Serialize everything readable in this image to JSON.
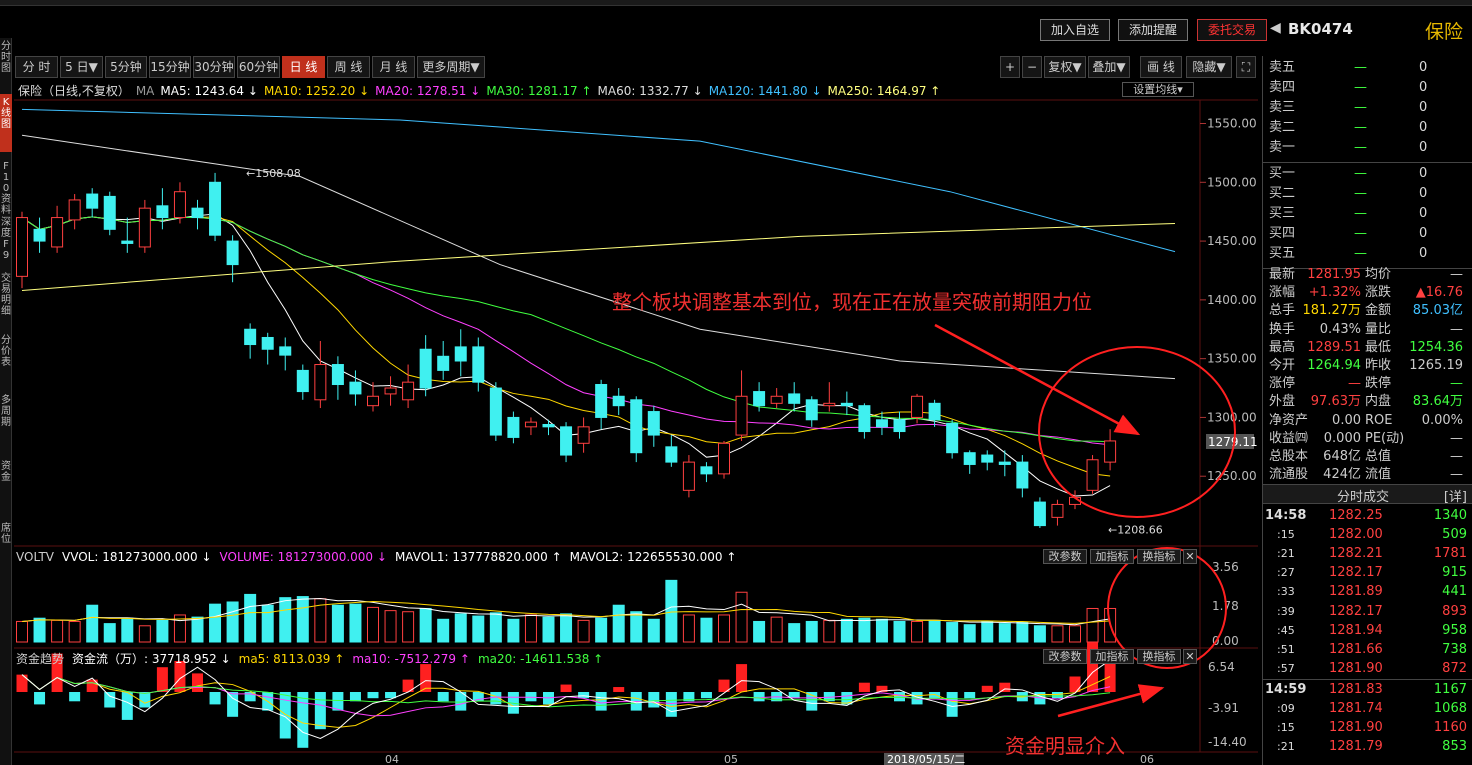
{
  "header": {
    "buttons": [
      "加入自选",
      "添加提醒",
      "委托交易"
    ],
    "code": "BK0474",
    "name": "保险"
  },
  "left_tabs": [
    "分时图",
    "K线图",
    "F10资料",
    "深度F9",
    "交易明细",
    "分价表",
    "多周期",
    "资金",
    "席位"
  ],
  "period_tabs": [
    "分 时",
    "5 日▼",
    "5分钟",
    "15分钟",
    "30分钟",
    "60分钟",
    "日 线",
    "周 线",
    "月 线",
    "更多周期▼"
  ],
  "active_period": "日 线",
  "tools": [
    "+",
    "−",
    "复权▼",
    "叠加▼",
    "画 线",
    "隐藏▼",
    "⛶"
  ],
  "ma_bar": {
    "title": "保险（日线,不复权）",
    "ma_label": "MA",
    "items": [
      {
        "text": "MA5: 1243.64 ↓",
        "color": "#ffffff"
      },
      {
        "text": "MA10: 1252.20 ↓",
        "color": "#ffd700"
      },
      {
        "text": "MA20: 1278.51 ↓",
        "color": "#ff40ff"
      },
      {
        "text": "MA30: 1281.17 ↑",
        "color": "#40ff40"
      },
      {
        "text": "MA60: 1332.77 ↓",
        "color": "#dddddd"
      },
      {
        "text": "MA120: 1441.80 ↓",
        "color": "#40c0ff"
      },
      {
        "text": "MA250: 1464.97 ↑",
        "color": "#ffff80"
      }
    ],
    "settings": "设置均线▾"
  },
  "price_axis": [
    "1550.00",
    "1500.00",
    "1450.00",
    "1400.00",
    "1350.00",
    "1300.00",
    "1250.00"
  ],
  "last_price_tag": "1279.11",
  "high_label": "1508.08",
  "low_label": "1208.66",
  "volume": {
    "title": "VOLTV",
    "items": [
      {
        "text": "VVOL: 181273000.000 ↓",
        "color": "#ffffff"
      },
      {
        "text": "VOLUME: 181273000.000 ↓",
        "color": "#ff40ff"
      },
      {
        "text": "MAVOL1: 137778820.000 ↑",
        "color": "#ffffff"
      },
      {
        "text": "MAVOL2: 122655530.000 ↑",
        "color": "#ffffff"
      }
    ],
    "axis": [
      "3.56",
      "1.78",
      "0.00"
    ]
  },
  "fund": {
    "title": "资金趋势",
    "items": [
      {
        "text": "资金流（万）: 37718.952 ↓",
        "color": "#ffffff"
      },
      {
        "text": "ma5: 8113.039 ↑",
        "color": "#ffd700"
      },
      {
        "text": "ma10: -7512.279 ↑",
        "color": "#ff40ff"
      },
      {
        "text": "ma20: -14611.538 ↑",
        "color": "#40ff40"
      }
    ],
    "axis": [
      "6.54",
      "-3.91",
      "-14.40"
    ]
  },
  "indicator_buttons": [
    "改参数",
    "加指标",
    "换指标",
    "✕"
  ],
  "date_axis": [
    "04",
    "05",
    "06"
  ],
  "date_tag": "2018/05/15/二",
  "annotations": {
    "main": "整个板块调整基本到位，现在正在放量突破前期阻力位",
    "fund": "资金明显介入"
  },
  "order_book": {
    "sells": [
      {
        "label": "卖五",
        "price": "—",
        "vol": "0"
      },
      {
        "label": "卖四",
        "price": "—",
        "vol": "0"
      },
      {
        "label": "卖三",
        "price": "—",
        "vol": "0"
      },
      {
        "label": "卖二",
        "price": "—",
        "vol": "0"
      },
      {
        "label": "卖一",
        "price": "—",
        "vol": "0"
      }
    ],
    "buys": [
      {
        "label": "买一",
        "price": "—",
        "vol": "0"
      },
      {
        "label": "买二",
        "price": "—",
        "vol": "0"
      },
      {
        "label": "买三",
        "price": "—",
        "vol": "0"
      },
      {
        "label": "买四",
        "price": "—",
        "vol": "0"
      },
      {
        "label": "买五",
        "price": "—",
        "vol": "0"
      }
    ]
  },
  "stats": [
    {
      "l1": "最新",
      "v1": "1281.95",
      "c1": "#ff4040",
      "l2": "均价",
      "v2": "—",
      "c2": "#ccc"
    },
    {
      "l1": "涨幅",
      "v1": "+1.32%",
      "c1": "#ff4040",
      "l2": "涨跌",
      "v2": "▲16.76",
      "c2": "#ff4040"
    },
    {
      "l1": "总手",
      "v1": "181.27万",
      "c1": "#ffd700",
      "l2": "金额",
      "v2": "85.03亿",
      "c2": "#40c0ff"
    },
    {
      "l1": "换手",
      "v1": "0.43%",
      "c1": "#ccc",
      "l2": "量比",
      "v2": "—",
      "c2": "#ccc"
    },
    {
      "l1": "最高",
      "v1": "1289.51",
      "c1": "#ff4040",
      "l2": "最低",
      "v2": "1254.36",
      "c2": "#40ff40"
    },
    {
      "l1": "今开",
      "v1": "1264.94",
      "c1": "#40ff40",
      "l2": "昨收",
      "v2": "1265.19",
      "c2": "#ccc"
    },
    {
      "l1": "涨停",
      "v1": "—",
      "c1": "#ff4040",
      "l2": "跌停",
      "v2": "—",
      "c2": "#40ff40"
    },
    {
      "l1": "外盘",
      "v1": "97.63万",
      "c1": "#ff4040",
      "l2": "内盘",
      "v2": "83.64万",
      "c2": "#40ff40"
    },
    {
      "l1": "净资产",
      "v1": "0.00",
      "c1": "#ccc",
      "l2": "ROE",
      "v2": "0.00%",
      "c2": "#ccc"
    },
    {
      "l1": "收益㈣",
      "v1": "0.000",
      "c1": "#ccc",
      "l2": "PE(动)",
      "v2": "—",
      "c2": "#ccc"
    },
    {
      "l1": "总股本",
      "v1": "648亿",
      "c1": "#ccc",
      "l2": "总值",
      "v2": "—",
      "c2": "#ccc"
    },
    {
      "l1": "流通股",
      "v1": "424亿",
      "c1": "#ccc",
      "l2": "流值",
      "v2": "—",
      "c2": "#ccc"
    }
  ],
  "ticks_header": "分时成交",
  "ticks_detail": "[详]",
  "ticks": [
    {
      "t": "14:58",
      "p": "1282.25",
      "v": "1340",
      "vc": "#40ff40"
    },
    {
      "t": ":15",
      "p": "1282.00",
      "v": "509",
      "vc": "#40ff40"
    },
    {
      "t": ":21",
      "p": "1282.21",
      "v": "1781",
      "vc": "#ff4040"
    },
    {
      "t": ":27",
      "p": "1282.17",
      "v": "915",
      "vc": "#40ff40"
    },
    {
      "t": ":33",
      "p": "1281.89",
      "v": "441",
      "vc": "#40ff40"
    },
    {
      "t": ":39",
      "p": "1282.17",
      "v": "893",
      "vc": "#ff4040"
    },
    {
      "t": ":45",
      "p": "1281.94",
      "v": "958",
      "vc": "#40ff40"
    },
    {
      "t": ":51",
      "p": "1281.66",
      "v": "738",
      "vc": "#40ff40"
    },
    {
      "t": ":57",
      "p": "1281.90",
      "v": "872",
      "vc": "#ff4040"
    },
    {
      "t": "14:59",
      "p": "1281.83",
      "v": "1167",
      "vc": "#40ff40"
    },
    {
      "t": ":09",
      "p": "1281.74",
      "v": "1068",
      "vc": "#40ff40"
    },
    {
      "t": ":15",
      "p": "1281.90",
      "v": "1160",
      "vc": "#ff4040"
    },
    {
      "t": ":21",
      "p": "1281.79",
      "v": "853",
      "vc": "#40ff40"
    }
  ],
  "chart_data": {
    "type": "candlestick",
    "y_range": [
      1200,
      1570
    ],
    "candles": [
      [
        1420,
        1470,
        1410,
        1475
      ],
      [
        1460,
        1450,
        1440,
        1470
      ],
      [
        1445,
        1470,
        1440,
        1480
      ],
      [
        1468,
        1485,
        1460,
        1490
      ],
      [
        1490,
        1478,
        1470,
        1495
      ],
      [
        1488,
        1460,
        1455,
        1492
      ],
      [
        1450,
        1448,
        1440,
        1470
      ],
      [
        1445,
        1478,
        1440,
        1485
      ],
      [
        1480,
        1470,
        1460,
        1495
      ],
      [
        1470,
        1492,
        1465,
        1500
      ],
      [
        1478,
        1470,
        1460,
        1485
      ],
      [
        1500,
        1455,
        1450,
        1508
      ],
      [
        1450,
        1430,
        1415,
        1455
      ],
      [
        1375,
        1362,
        1350,
        1380
      ],
      [
        1368,
        1358,
        1345,
        1372
      ],
      [
        1360,
        1353,
        1340,
        1368
      ],
      [
        1340,
        1322,
        1315,
        1345
      ],
      [
        1315,
        1345,
        1308,
        1365
      ],
      [
        1345,
        1328,
        1315,
        1352
      ],
      [
        1330,
        1320,
        1310,
        1340
      ],
      [
        1310,
        1318,
        1305,
        1330
      ],
      [
        1320,
        1325,
        1310,
        1335
      ],
      [
        1315,
        1330,
        1308,
        1345
      ],
      [
        1358,
        1325,
        1318,
        1370
      ],
      [
        1352,
        1340,
        1332,
        1365
      ],
      [
        1360,
        1348,
        1335,
        1375
      ],
      [
        1360,
        1330,
        1322,
        1368
      ],
      [
        1325,
        1285,
        1280,
        1330
      ],
      [
        1300,
        1283,
        1278,
        1305
      ],
      [
        1292,
        1296,
        1285,
        1300
      ],
      [
        1294,
        1292,
        1285,
        1298
      ],
      [
        1292,
        1268,
        1262,
        1296
      ],
      [
        1278,
        1292,
        1270,
        1300
      ],
      [
        1328,
        1300,
        1290,
        1332
      ],
      [
        1318,
        1310,
        1302,
        1325
      ],
      [
        1315,
        1270,
        1262,
        1318
      ],
      [
        1305,
        1285,
        1275,
        1310
      ],
      [
        1275,
        1262,
        1258,
        1285
      ],
      [
        1238,
        1262,
        1232,
        1268
      ],
      [
        1258,
        1252,
        1245,
        1262
      ],
      [
        1252,
        1278,
        1248,
        1280
      ],
      [
        1285,
        1318,
        1280,
        1340
      ],
      [
        1322,
        1310,
        1305,
        1330
      ],
      [
        1312,
        1318,
        1308,
        1325
      ],
      [
        1320,
        1312,
        1305,
        1330
      ],
      [
        1315,
        1298,
        1292,
        1318
      ],
      [
        1310,
        1312,
        1305,
        1330
      ],
      [
        1312,
        1310,
        1302,
        1322
      ],
      [
        1310,
        1288,
        1282,
        1312
      ],
      [
        1298,
        1292,
        1285,
        1305
      ],
      [
        1298,
        1288,
        1282,
        1305
      ],
      [
        1300,
        1318,
        1295,
        1320
      ],
      [
        1312,
        1298,
        1292,
        1315
      ],
      [
        1295,
        1270,
        1265,
        1298
      ],
      [
        1270,
        1260,
        1252,
        1272
      ],
      [
        1268,
        1262,
        1255,
        1272
      ],
      [
        1262,
        1260,
        1250,
        1272
      ],
      [
        1262,
        1240,
        1232,
        1268
      ],
      [
        1228,
        1208,
        1206,
        1232
      ],
      [
        1215,
        1226,
        1208,
        1230
      ],
      [
        1226,
        1232,
        1222,
        1238
      ],
      [
        1238,
        1264,
        1235,
        1268
      ],
      [
        1262,
        1280,
        1255,
        1290
      ]
    ],
    "volumes": [
      0.95,
      1.1,
      1.0,
      0.95,
      1.7,
      0.85,
      1.1,
      0.75,
      1.0,
      1.25,
      1.15,
      1.75,
      1.85,
      2.2,
      1.7,
      2.05,
      2.1,
      2.0,
      1.7,
      1.75,
      1.6,
      1.45,
      1.4,
      1.55,
      1.05,
      1.3,
      1.2,
      1.35,
      1.05,
      1.25,
      1.15,
      1.3,
      1.0,
      1.1,
      1.7,
      1.4,
      1.05,
      2.85,
      1.25,
      1.1,
      1.25,
      2.3,
      0.95,
      1.15,
      0.85,
      0.95,
      1.0,
      1.05,
      1.1,
      1.05,
      0.95,
      0.95,
      1.0,
      0.9,
      0.8,
      0.95,
      0.85,
      0.9,
      0.75,
      0.75,
      0.75,
      1.55,
      1.55
    ],
    "funds": [
      2.8,
      -2.0,
      6.2,
      -1.5,
      2.0,
      -2.5,
      -4.5,
      -2.5,
      4.0,
      5.0,
      3.0,
      -2.0,
      -4.0,
      -1.5,
      -3.0,
      -7.5,
      -9.0,
      -6.0,
      -3.0,
      -1.5,
      -1.0,
      -1.0,
      2.0,
      4.5,
      -1.5,
      -3.0,
      -1.5,
      -2.0,
      -3.5,
      -1.5,
      -2.0,
      1.2,
      -1.0,
      -3.0,
      0.8,
      -3.0,
      -2.5,
      -4.0,
      -1.5,
      -1.0,
      2.0,
      4.5,
      -1.5,
      -1.5,
      -1.0,
      -3.0,
      -1.5,
      -2.0,
      1.5,
      1.0,
      -1.5,
      -2.0,
      -1.0,
      -4.0,
      -1.0,
      1.0,
      1.5,
      -1.5,
      -2.0,
      -1.0,
      2.5,
      8.0,
      5.0
    ]
  }
}
